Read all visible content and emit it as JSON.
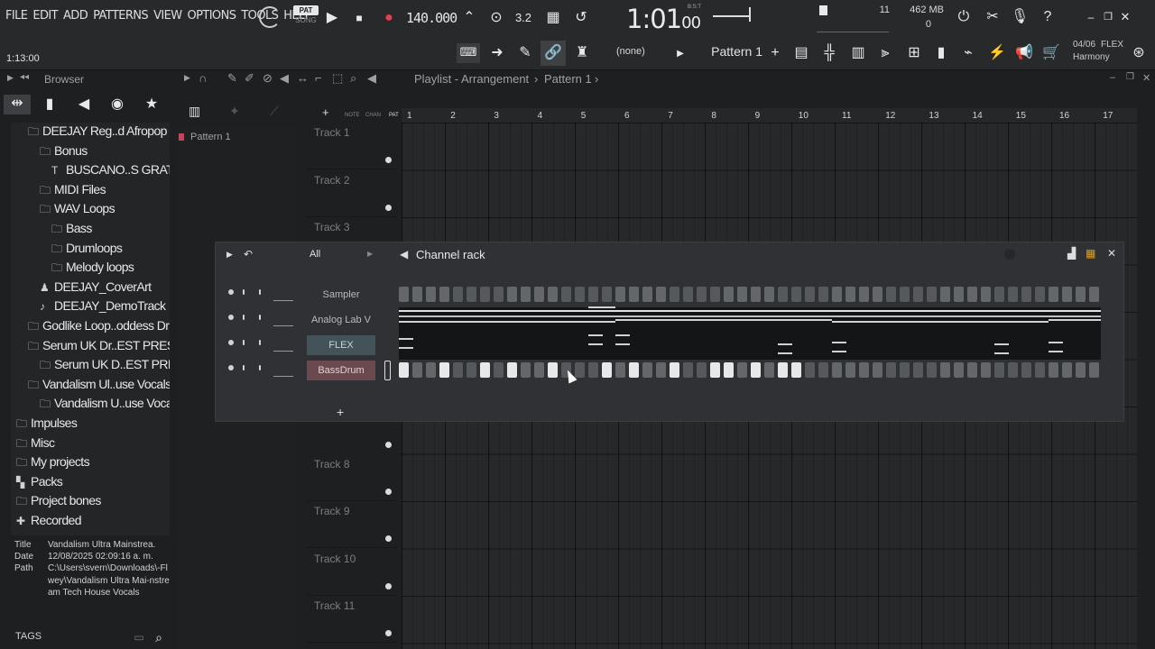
{
  "menu": [
    "FILE",
    "EDIT",
    "ADD",
    "PATTERNS",
    "VIEW",
    "OPTIONS",
    "TOOLS",
    "HELP"
  ],
  "transport": {
    "pat_label": "PAT",
    "song_label": "SONG",
    "tempo": "140.000",
    "time_main": "1:01",
    "time_sub": "00",
    "time_unit": "B:S:T",
    "cpu_value": "11",
    "memory": "462 MB",
    "voices": "0",
    "hint_date": "04/06",
    "hint_mode": "FLEX",
    "hint_name": "Harmony"
  },
  "toolbar2": {
    "clock": "1:13:00",
    "pattern_selector": "Pattern 1",
    "snap_value": "(none)"
  },
  "browser": {
    "title": "Browser",
    "tree": [
      {
        "label": "DEEJAY Reg..d Afropop",
        "icon": "folder",
        "indent": 1
      },
      {
        "label": "Bonus",
        "icon": "folder",
        "indent": 2
      },
      {
        "label": "BUSCANO..S GRATIS",
        "icon": "text",
        "indent": 3
      },
      {
        "label": "MIDI Files",
        "icon": "folder",
        "indent": 2
      },
      {
        "label": "WAV Loops",
        "icon": "folder",
        "indent": 2
      },
      {
        "label": "Bass",
        "icon": "folder",
        "indent": 3
      },
      {
        "label": "Drumloops",
        "icon": "folder",
        "indent": 3
      },
      {
        "label": "Melody loops",
        "icon": "folder",
        "indent": 3
      },
      {
        "label": "DEEJAY_CoverArt",
        "icon": "image",
        "indent": 2
      },
      {
        "label": "DEEJAY_DemoTrack",
        "icon": "mp3",
        "indent": 2
      },
      {
        "label": "Godlike Loop..oddess Drill",
        "icon": "folder",
        "indent": 1
      },
      {
        "label": "Serum UK Dr..EST PRESS",
        "icon": "folder",
        "indent": 1
      },
      {
        "label": "Serum UK D..EST PRESS",
        "icon": "folder",
        "indent": 2
      },
      {
        "label": "Vandalism Ul..use Vocals",
        "icon": "folder",
        "indent": 1
      },
      {
        "label": "Vandalism U..use Vocals",
        "icon": "folder",
        "indent": 2
      },
      {
        "label": "Impulses",
        "icon": "folder",
        "indent": 0
      },
      {
        "label": "Misc",
        "icon": "folder",
        "indent": 0
      },
      {
        "label": "My projects",
        "icon": "folder",
        "indent": 0
      },
      {
        "label": "Packs",
        "icon": "packs",
        "indent": 0
      },
      {
        "label": "Project bones",
        "icon": "folder",
        "indent": 0
      },
      {
        "label": "Recorded",
        "icon": "plus",
        "indent": 0
      },
      {
        "label": "Rendered",
        "icon": "plus",
        "indent": 0
      }
    ],
    "info": {
      "title_key": "Title",
      "title_val": "Vandalism Ultra Mainstrea.",
      "date_key": "Date",
      "date_val": "12/08/2025 02:09:16 a. m.",
      "path_key": "Path",
      "path_val": "C:\\Users\\svern\\Downloads\\-Flwey\\Vandalism Ultra Mai-nstream Tech House Vocals"
    },
    "tags_label": "TAGS"
  },
  "playlist": {
    "title": "Playlist - Arrangement",
    "pattern": "Pattern 1",
    "tool_labels": [
      "NOTE",
      "CHAN",
      "PAT"
    ],
    "pattern_list_item": "Pattern 1",
    "bars": [
      "1",
      "2",
      "3",
      "4",
      "5",
      "6",
      "7",
      "8",
      "9",
      "10",
      "11",
      "12",
      "13",
      "14",
      "15",
      "16",
      "17"
    ],
    "tracks": [
      "Track 1",
      "Track 2",
      "Track 3",
      "Track 8",
      "Track 9",
      "Track 10",
      "Track 11"
    ]
  },
  "channel_rack": {
    "title": "Channel rack",
    "filter": "All",
    "channels": [
      {
        "name": "Sampler",
        "style": "plain"
      },
      {
        "name": "Analog Lab V",
        "style": "plain"
      },
      {
        "name": "FLEX",
        "style": "flex"
      },
      {
        "name": "BassDrum",
        "style": "bass"
      }
    ],
    "bassdrum_on_steps": [
      0,
      3,
      6,
      8,
      11,
      15,
      17,
      20,
      23,
      24,
      26,
      28,
      29
    ]
  },
  "colors": {
    "accent_red": "#e33f4c",
    "background": "#1d1f21",
    "rack_bg": "#2f3134"
  }
}
